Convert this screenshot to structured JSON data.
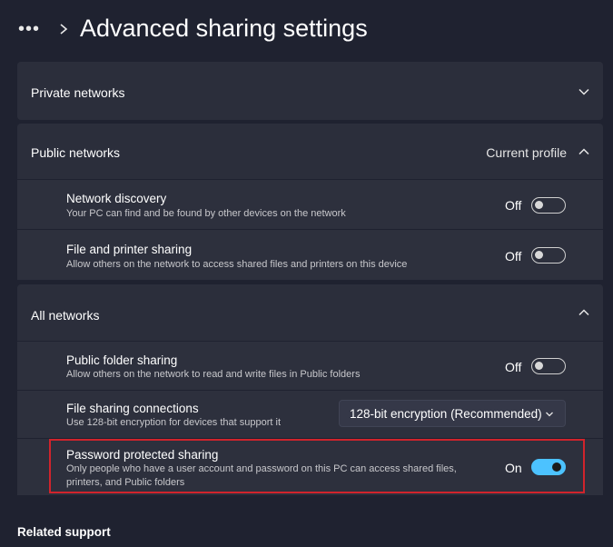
{
  "header": {
    "more_label": "•••",
    "title": "Advanced sharing settings"
  },
  "private_networks": {
    "title": "Private networks"
  },
  "public_networks": {
    "title": "Public networks",
    "badge": "Current profile",
    "items": [
      {
        "title": "Network discovery",
        "desc": "Your PC can find and be found by other devices on the network",
        "state": "Off"
      },
      {
        "title": "File and printer sharing",
        "desc": "Allow others on the network to access shared files and printers on this device",
        "state": "Off"
      }
    ]
  },
  "all_networks": {
    "title": "All networks",
    "public_folder": {
      "title": "Public folder sharing",
      "desc": "Allow others on the network to read and write files in Public folders",
      "state": "Off"
    },
    "file_sharing_connections": {
      "title": "File sharing connections",
      "desc": "Use 128-bit encryption for devices that support it",
      "selected": "128-bit encryption (Recommended)"
    },
    "password_protected": {
      "title": "Password protected sharing",
      "desc_line1": "Only people who have a user account and password on this PC can access shared files,",
      "desc_line2": "printers, and Public folders",
      "state": "On"
    }
  },
  "footer": {
    "related": "Related support"
  },
  "colors": {
    "accent": "#4cc2ff",
    "highlight": "#d0242c",
    "background": "#1f2230",
    "card": "#2b2e3b"
  },
  "icons": {
    "breadcrumb_separator": "chevron-right-icon",
    "collapsed": "chevron-down-icon",
    "expanded": "chevron-up-icon"
  }
}
